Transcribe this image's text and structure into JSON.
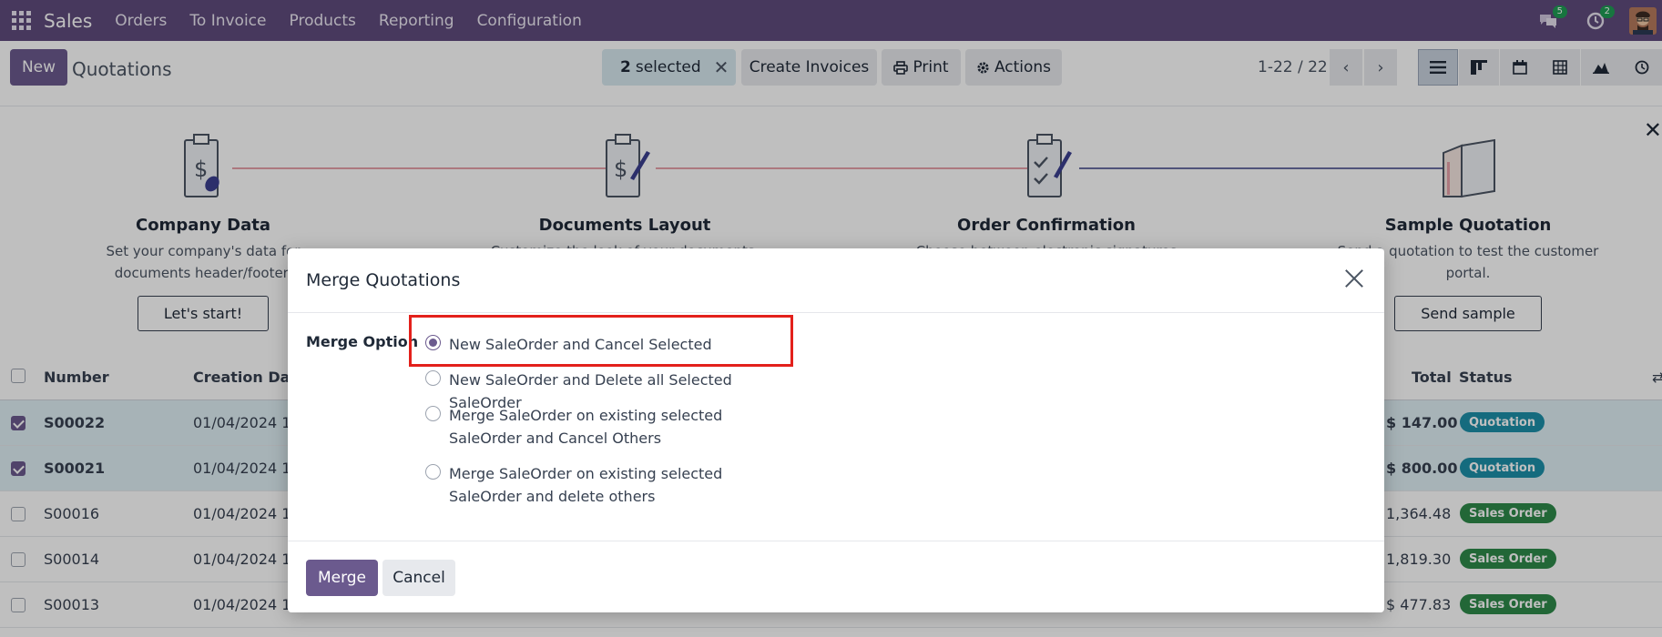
{
  "navbar": {
    "app_name": "Sales",
    "menu": [
      "Orders",
      "To Invoice",
      "Products",
      "Reporting",
      "Configuration"
    ],
    "messages_count": "5",
    "activities_count": "2"
  },
  "control_panel": {
    "new_label": "New",
    "title": "Quotations",
    "selected_count": "2",
    "selected_label": "selected",
    "create_invoices_label": "Create Invoices",
    "print_label": "Print",
    "actions_label": "Actions",
    "pager": "1-22 / 22"
  },
  "onboarding": {
    "steps": [
      {
        "title": "Company Data",
        "desc": "Set your company's data for documents header/footer.",
        "button": "Let's start!"
      },
      {
        "title": "Documents Layout",
        "desc": "Customize the look of your documents.",
        "button": ""
      },
      {
        "title": "Order Confirmation",
        "desc": "Choose between electronic signatures",
        "button": ""
      },
      {
        "title": "Sample Quotation",
        "desc": "Send a quotation to test the customer portal.",
        "button": "Send sample"
      }
    ]
  },
  "list": {
    "headers": {
      "number": "Number",
      "creation_date": "Creation Date",
      "total": "Total",
      "status": "Status"
    },
    "rows": [
      {
        "number": "S00022",
        "date": "01/04/2024 1",
        "total": "$ 147.00",
        "status": "Quotation",
        "selected": true
      },
      {
        "number": "S00021",
        "date": "01/04/2024 1",
        "total": "$ 800.00",
        "status": "Quotation",
        "selected": true
      },
      {
        "number": "S00016",
        "date": "01/04/2024 1",
        "total": "1,364.48",
        "status": "Sales Order",
        "selected": false
      },
      {
        "number": "S00014",
        "date": "01/04/2024 1",
        "total": "1,819.30",
        "status": "Sales Order",
        "selected": false
      },
      {
        "number": "S00013",
        "date": "01/04/2024 1",
        "total": "$ 477.83",
        "status": "Sales Order",
        "selected": false
      }
    ]
  },
  "modal": {
    "title": "Merge Quotations",
    "option_label": "Merge Option",
    "options": [
      "New SaleOrder and Cancel Selected",
      "New SaleOrder and Delete all Selected SaleOrder",
      "Merge SaleOrder on existing selected SaleOrder and Cancel Others",
      "Merge SaleOrder on existing selected SaleOrder and delete others"
    ],
    "selected_option": "New SaleOrder and Cancel Selected",
    "merge_label": "Merge",
    "cancel_label": "Cancel"
  },
  "colors": {
    "brand": "#5f4b7c",
    "primary": "#6b5a8e",
    "highlight": "#e3201b"
  }
}
